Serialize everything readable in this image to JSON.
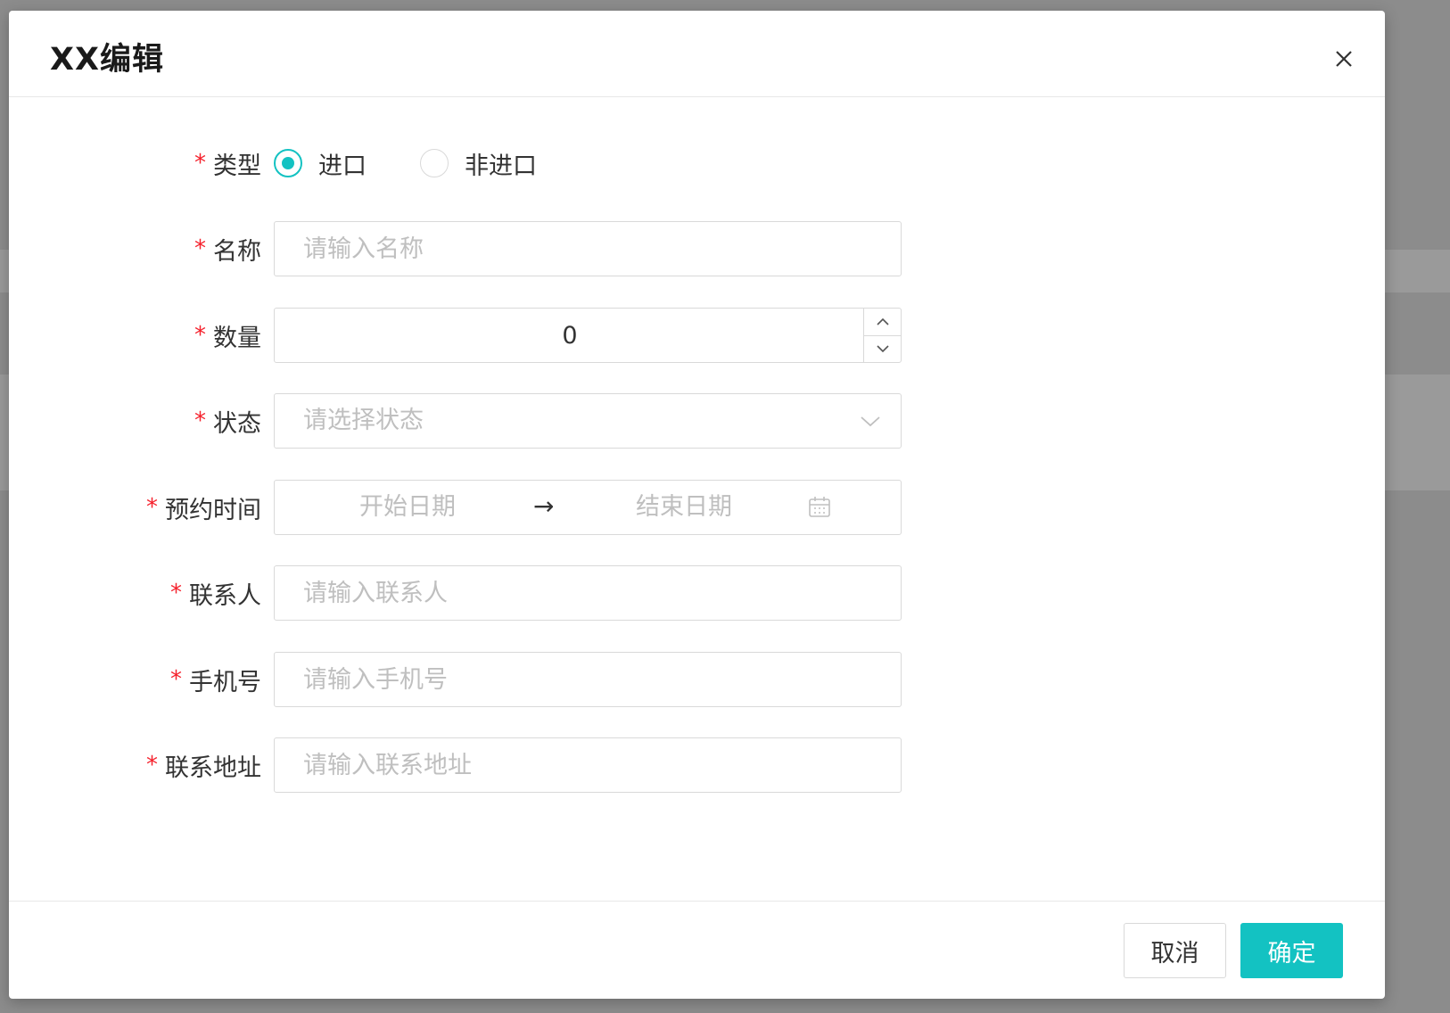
{
  "dialog": {
    "title": "XX编辑"
  },
  "form": {
    "type": {
      "label": "类型",
      "options": [
        "进口",
        "非进口"
      ],
      "selected": "进口"
    },
    "name": {
      "label": "名称",
      "placeholder": "请输入名称"
    },
    "quantity": {
      "label": "数量",
      "value": "0"
    },
    "status": {
      "label": "状态",
      "placeholder": "请选择状态"
    },
    "appointment": {
      "label": "预约时间",
      "start_placeholder": "开始日期",
      "separator": "→",
      "end_placeholder": "结束日期"
    },
    "contact": {
      "label": "联系人",
      "placeholder": "请输入联系人"
    },
    "phone": {
      "label": "手机号",
      "placeholder": "请输入手机号"
    },
    "address": {
      "label": "联系地址",
      "placeholder": "请输入联系地址"
    },
    "required_mark": "*"
  },
  "footer": {
    "cancel_label": "取消",
    "ok_label": "确定"
  },
  "colors": {
    "accent": "#13c2c2",
    "required": "#f5222d",
    "placeholder": "#bfbfbf",
    "border": "#d9d9d9"
  },
  "icons": {
    "close": "close-icon",
    "step_up": "chevron-up-icon",
    "step_down": "chevron-down-icon",
    "select": "chevron-down-icon",
    "calendar": "calendar-icon"
  }
}
